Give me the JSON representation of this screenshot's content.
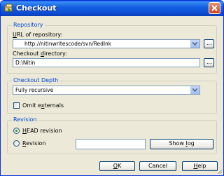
{
  "window": {
    "title": "Checkout"
  },
  "repository": {
    "group_label": "Repository",
    "url_label_prefix": "U",
    "url_label_rest": "RL of repository:",
    "url_value": "http://nitinwritescode/svn/RedInk",
    "dir_label_prefix": "Checkout ",
    "dir_label_accel": "d",
    "dir_label_rest": "irectory:",
    "dir_value": "D:\\Nitin",
    "browse_label": "..."
  },
  "depth": {
    "group_label": "Checkout Depth",
    "value": "Fully recursive",
    "omit_prefix": "Omit e",
    "omit_accel": "x",
    "omit_rest": "ternals",
    "omit_checked": false
  },
  "revision": {
    "group_label": "Revision",
    "head_accel": "H",
    "head_rest": "EAD revision",
    "rev_accel": "R",
    "rev_rest": "evision",
    "rev_value": "",
    "selected": "HEAD revision",
    "showlog_prefix": "Show ",
    "showlog_accel": "l",
    "showlog_rest": "og"
  },
  "buttons": {
    "ok_accel": "O",
    "ok_rest": "K",
    "cancel_label": "Cancel",
    "help_accel": "H",
    "help_rest": "elp"
  }
}
